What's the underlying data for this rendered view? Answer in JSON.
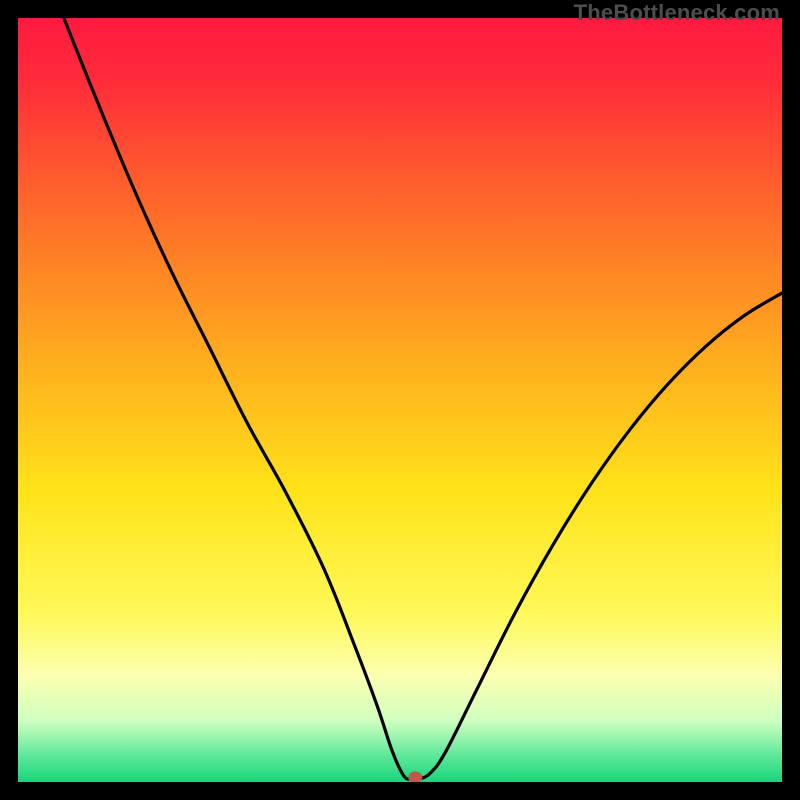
{
  "watermark": "TheBottleneck.com",
  "chart_data": {
    "type": "line",
    "title": "",
    "xlabel": "",
    "ylabel": "",
    "xlim": [
      0,
      100
    ],
    "ylim": [
      0,
      100
    ],
    "gradient_stops": [
      {
        "offset": 0.0,
        "color": "#ff1a3f"
      },
      {
        "offset": 0.08,
        "color": "#ff2b3a"
      },
      {
        "offset": 0.25,
        "color": "#ff6a2a"
      },
      {
        "offset": 0.45,
        "color": "#ffae1e"
      },
      {
        "offset": 0.62,
        "color": "#ffe31a"
      },
      {
        "offset": 0.78,
        "color": "#fff95a"
      },
      {
        "offset": 0.86,
        "color": "#fcffb0"
      },
      {
        "offset": 0.92,
        "color": "#cfffc0"
      },
      {
        "offset": 0.965,
        "color": "#5fe89a"
      },
      {
        "offset": 1.0,
        "color": "#17d67a"
      }
    ],
    "series": [
      {
        "name": "curve",
        "x": [
          6,
          10,
          15,
          20,
          25,
          30,
          35,
          40,
          44,
          47,
          49,
          50.5,
          51.5,
          52.5,
          54,
          56,
          60,
          65,
          70,
          75,
          80,
          85,
          90,
          95,
          100
        ],
        "y": [
          100,
          90,
          78,
          67,
          57,
          47,
          38,
          28,
          18,
          10,
          4,
          0.8,
          0.4,
          0.4,
          1.2,
          4,
          12,
          22,
          31,
          39,
          46,
          52,
          57,
          61,
          64
        ]
      }
    ],
    "marker": {
      "x": 52,
      "y": 0.6,
      "color": "#bb5a4a"
    }
  }
}
